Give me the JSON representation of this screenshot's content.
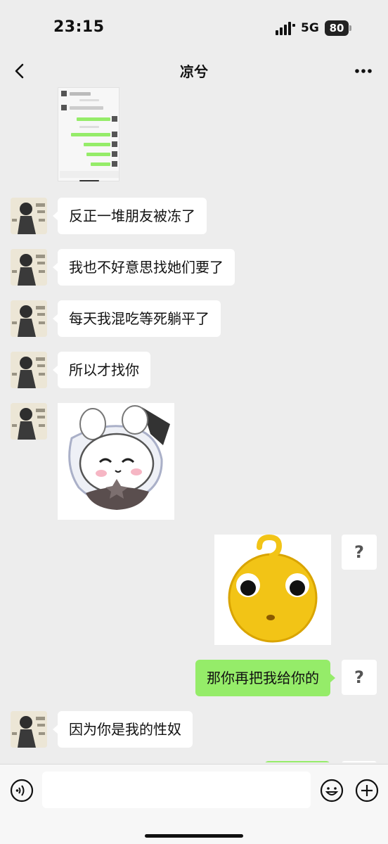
{
  "status": {
    "time": "23:15",
    "network": "5G",
    "battery": "80"
  },
  "header": {
    "title": "凉兮"
  },
  "messages": {
    "m1": "反正一堆朋友被冻了",
    "m2": "我也不好意思找她们要了",
    "m3": "每天我混吃等死躺平了",
    "m4": "所以才找你",
    "m5": "那你再把我给你的",
    "m6": "因为你是我的性奴"
  },
  "failed_mark": "?",
  "input": {
    "value": "",
    "placeholder": ""
  },
  "icons": {
    "back": "chevron-left-icon",
    "more": "more-dots-icon",
    "voice": "voice-icon",
    "emoji": "smiley-icon",
    "plus": "plus-circle-icon"
  },
  "colors": {
    "background": "#ededed",
    "outgoing_bubble": "#95ec69",
    "incoming_bubble": "#ffffff"
  }
}
